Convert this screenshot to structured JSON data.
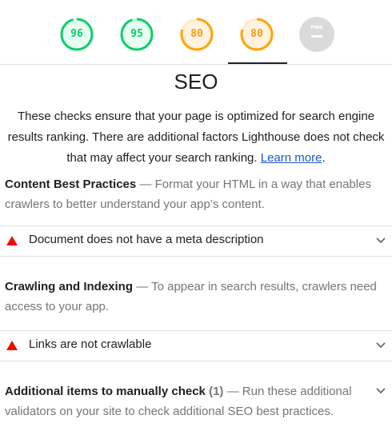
{
  "gauges": [
    {
      "score": "96",
      "fraction": 0.96,
      "color": "#0cce6b",
      "status": "pass"
    },
    {
      "score": "95",
      "fraction": 0.95,
      "color": "#0cce6b",
      "status": "pass"
    },
    {
      "score": "80",
      "fraction": 0.8,
      "color": "#ffa400",
      "status": "average"
    },
    {
      "score": "80",
      "fraction": 0.8,
      "color": "#ffa400",
      "status": "average",
      "selected": true
    },
    {
      "score": "PWA",
      "status": "pwa"
    }
  ],
  "category": {
    "title": "SEO",
    "description": "These checks ensure that your page is optimized for search engine results ranking. There are additional factors Lighthouse does not check that may affect your search ranking.",
    "learn_more": "Learn more",
    "description_end": "."
  },
  "groups": {
    "content": {
      "title": "Content Best Practices",
      "description": "Format your HTML in a way that enables crawlers to better understand your app’s content."
    },
    "crawling": {
      "title": "Crawling and Indexing",
      "description": "To appear in search results, crawlers need access to your app."
    },
    "manual": {
      "title": "Additional items to manually check",
      "count": "(1)",
      "description": "Run these additional validators on your site to check additional SEO best practices."
    }
  },
  "audits": {
    "meta_description": {
      "label": "Document does not have a meta description",
      "status": "fail"
    },
    "links_crawlable": {
      "label": "Links are not crawlable",
      "status": "fail"
    }
  },
  "colors": {
    "pass": "#0cce6b",
    "average": "#ffa400",
    "fail": "#eb0f00",
    "pwa": "#dadada"
  }
}
